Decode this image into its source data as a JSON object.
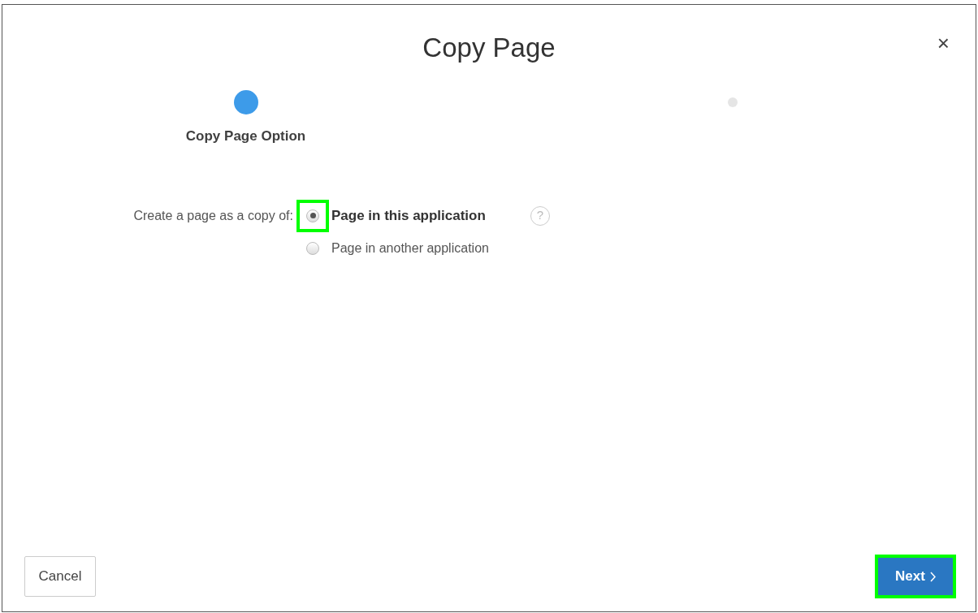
{
  "dialog": {
    "title": "Copy Page",
    "close": "×"
  },
  "steps": [
    {
      "label": "Copy Page Option",
      "selected": true
    },
    {
      "selected": false
    }
  ],
  "form": {
    "label": "Create a page as a copy of:",
    "options": [
      {
        "label": "Page in this application",
        "selected": true,
        "highlighted": true
      },
      {
        "label": "Page in another application",
        "selected": false,
        "highlighted": false
      }
    ],
    "help": "?"
  },
  "buttons": {
    "cancel": {
      "label": "Cancel"
    },
    "next": {
      "label": "Next",
      "highlighted": true
    }
  }
}
